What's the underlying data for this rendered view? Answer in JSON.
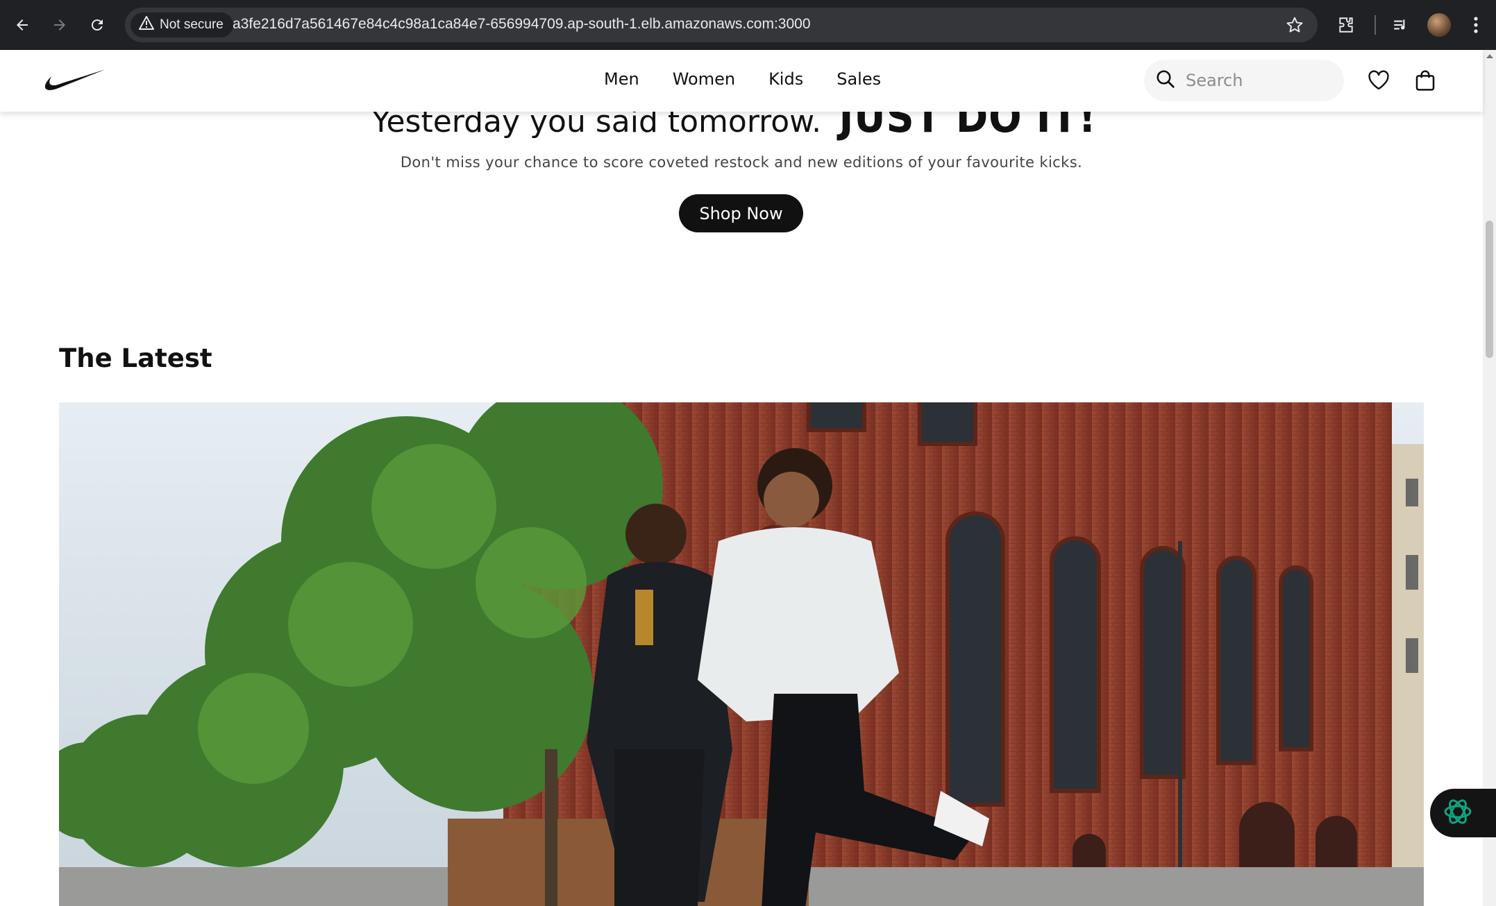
{
  "browser": {
    "security_label": "Not secure",
    "url": "a3fe216d7a561467e84c4c98a1ca84e7-656994709.ap-south-1.elb.amazonaws.com:3000",
    "icons": [
      "back-icon",
      "forward-icon",
      "reload-icon",
      "warning-icon",
      "star-icon",
      "extensions-icon",
      "media-icon",
      "profile-avatar",
      "menu-icon"
    ]
  },
  "header": {
    "nav": [
      "Men",
      "Women",
      "Kids",
      "Sales"
    ],
    "search_placeholder": "Search",
    "icons": [
      "nike-logo",
      "search-icon",
      "heart-icon",
      "bag-icon"
    ]
  },
  "hero": {
    "title_light": "Yesterday you said tomorrow.",
    "title_bold": "JUST DO IT!",
    "subtitle": "Don't miss your chance to score coveted restock and new editions of your favourite kicks.",
    "cta_label": "Shop Now"
  },
  "latest": {
    "heading": "The Latest"
  },
  "colors": {
    "chrome_bg": "#202124",
    "omnibox_bg": "#35363a",
    "brand_black": "#111111",
    "search_bg": "#f5f5f5",
    "brick": "#8e3b2a",
    "assistant_accent": "#10a37f"
  }
}
